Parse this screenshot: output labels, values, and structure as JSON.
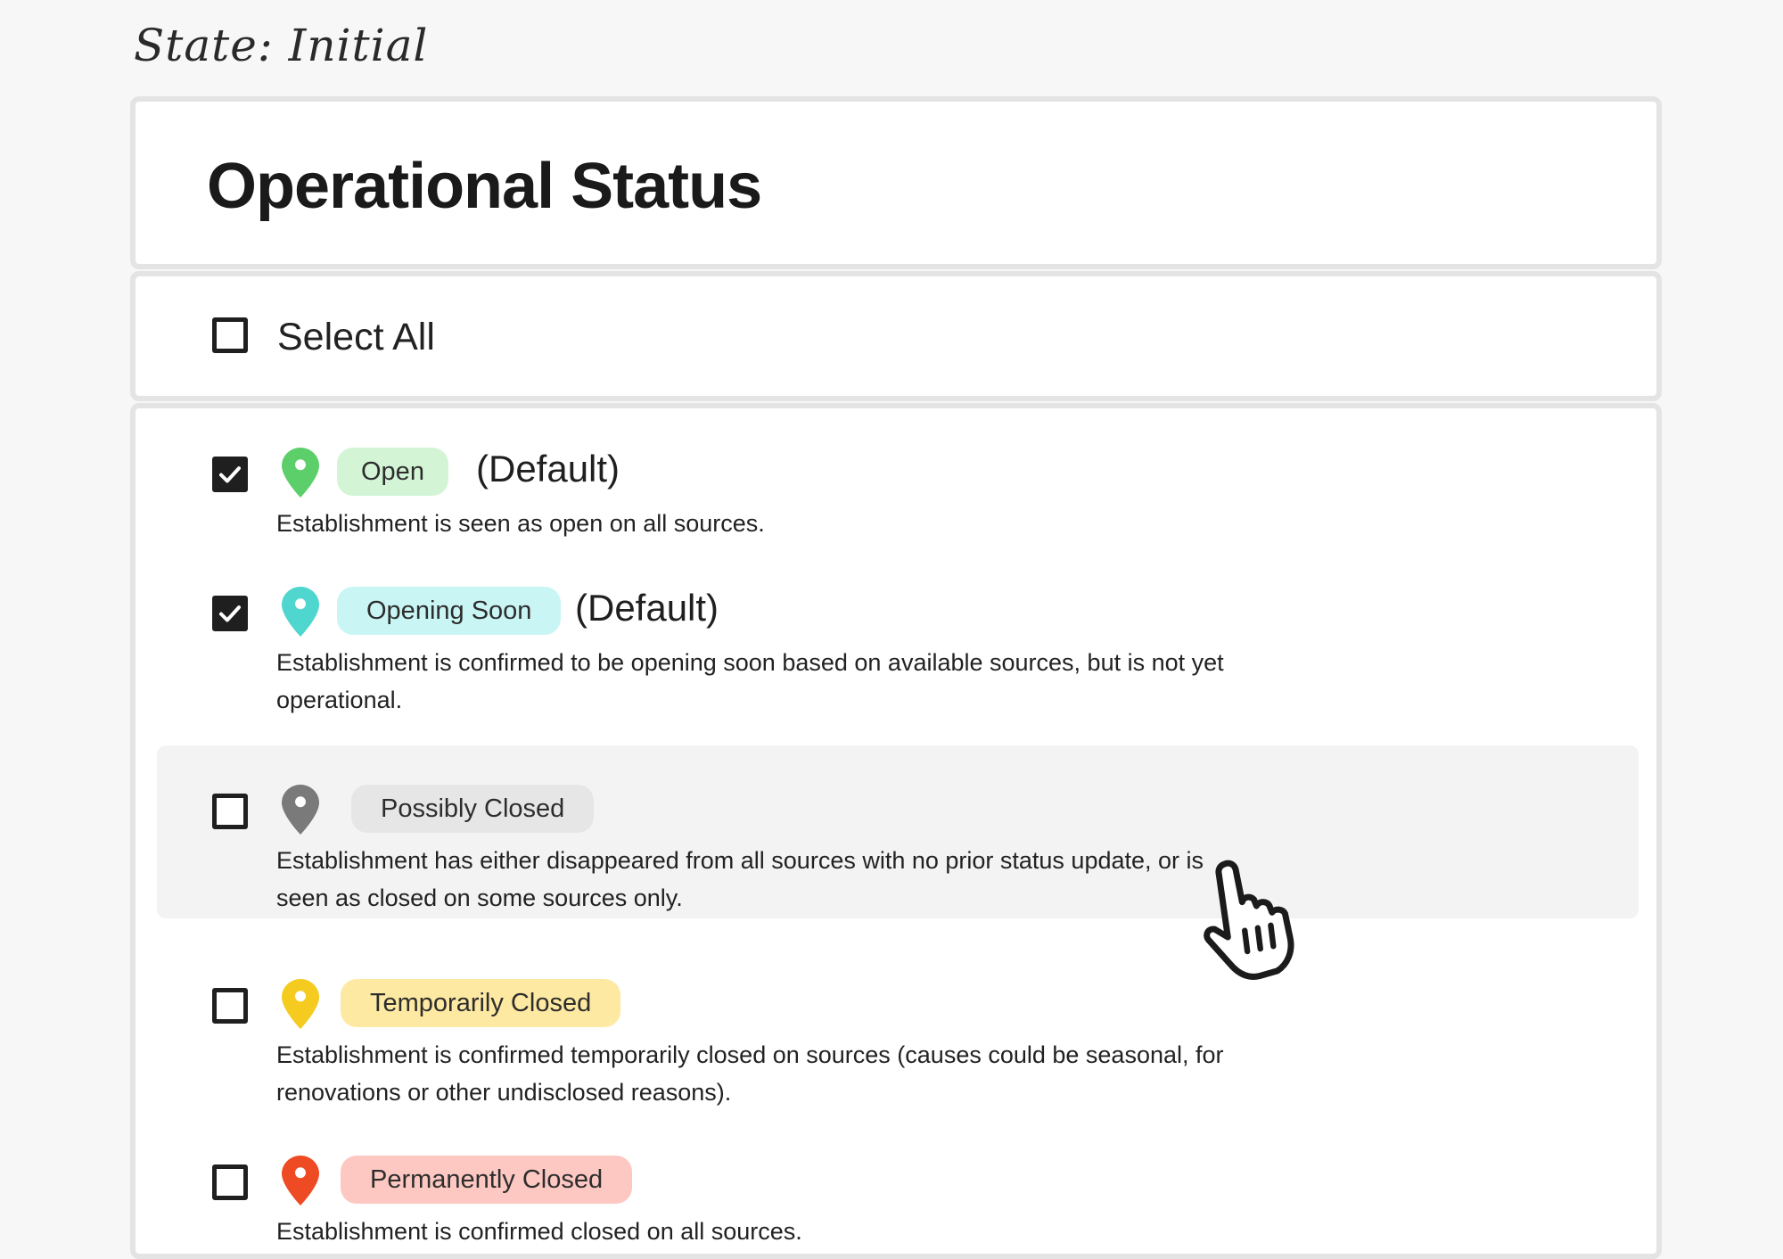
{
  "state_label": "State: Initial",
  "title": "Operational Status",
  "select_all": {
    "label": "Select All",
    "checked": false
  },
  "options": [
    {
      "label": "Open",
      "default_tag": "(Default)",
      "checked": true,
      "pin_color": "#5ccf6a",
      "badge_bg": "#d3f5d6",
      "description": "Establishment is seen as open on all sources."
    },
    {
      "label": "Opening Soon",
      "default_tag": "(Default)",
      "checked": true,
      "pin_color": "#4fd6cf",
      "badge_bg": "#c9f6f4",
      "description": "Establishment is confirmed to be opening soon based on available sources, but is not yet operational."
    },
    {
      "label": "Possibly Closed",
      "checked": false,
      "hovered": true,
      "pin_color": "#7a7a7a",
      "badge_bg": "#e6e6e6",
      "description": "Establishment has either disappeared from all sources with no prior status update, or is seen as closed on some sources only."
    },
    {
      "label": "Temporarily Closed",
      "checked": false,
      "pin_color": "#f5cb1f",
      "badge_bg": "#fde9a2",
      "description": "Establishment is confirmed temporarily closed on sources (causes could be seasonal, for renovations or other undisclosed reasons)."
    },
    {
      "label": "Permanently Closed",
      "checked": false,
      "pin_color": "#ee4b24",
      "badge_bg": "#fdc8c2",
      "description": "Establishment is confirmed closed on all sources."
    }
  ]
}
